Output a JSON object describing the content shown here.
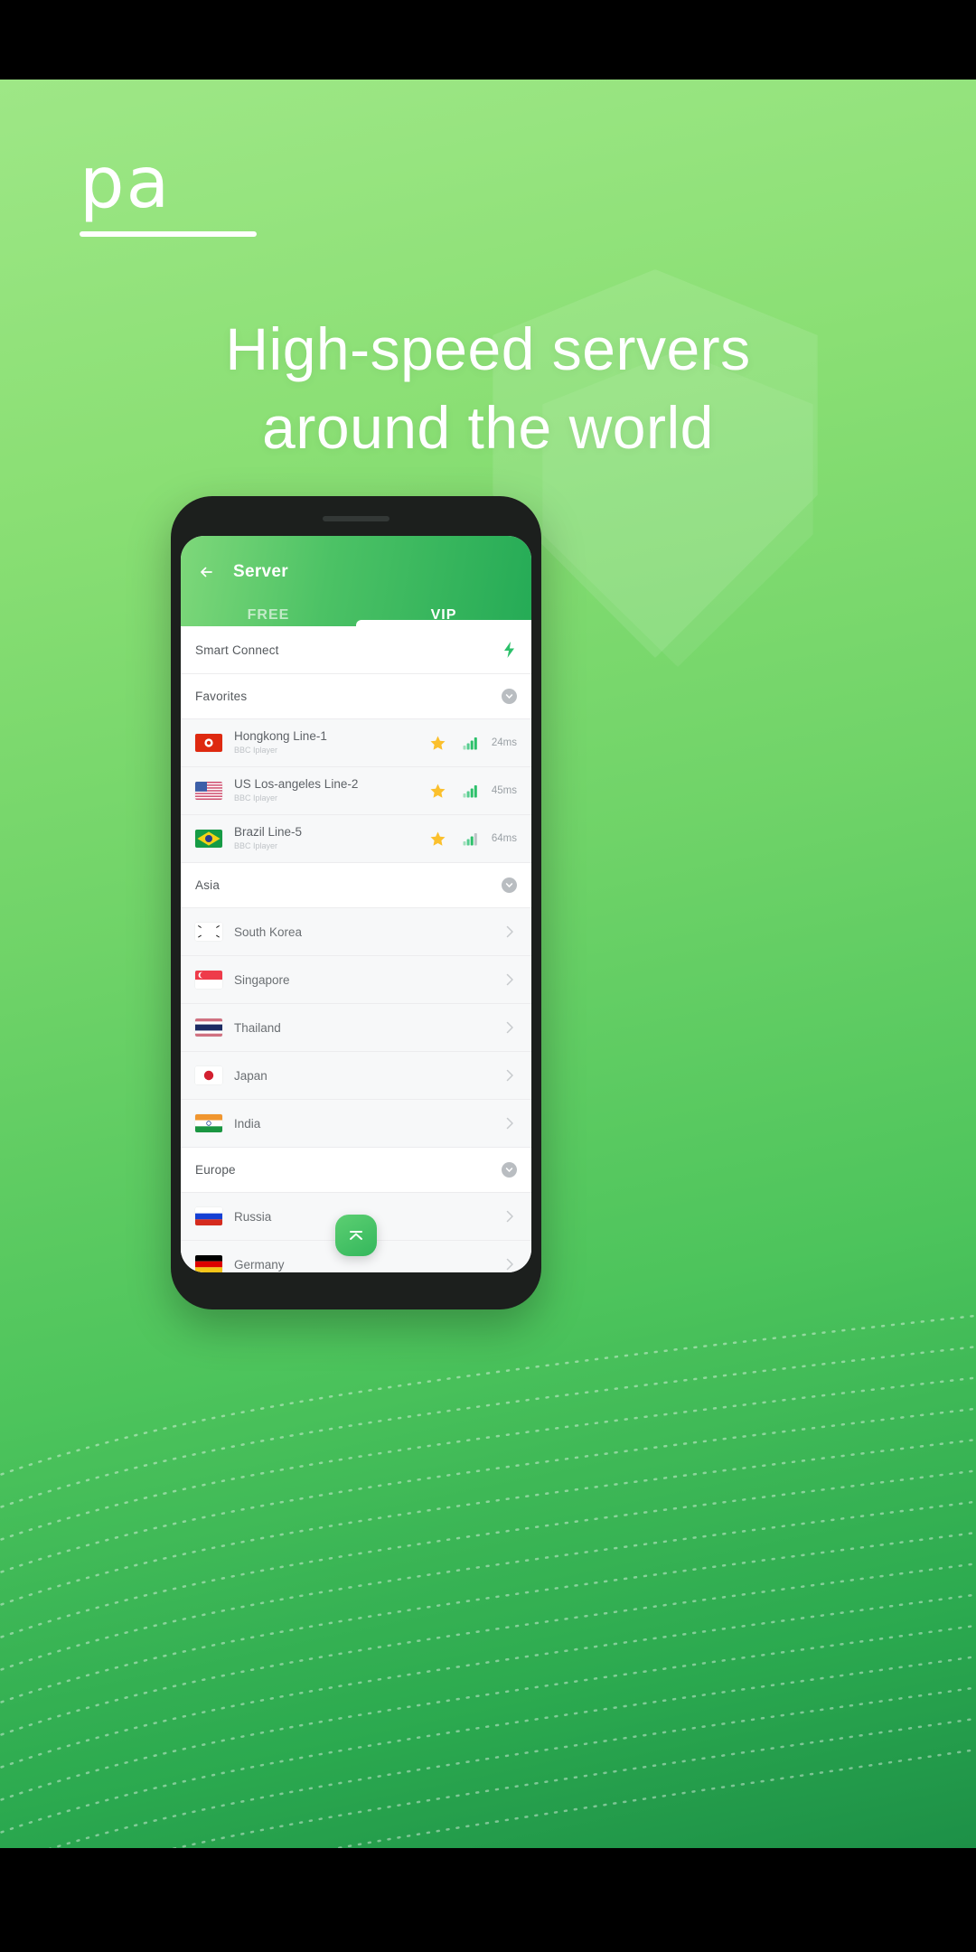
{
  "poster": {
    "logo_mark": "pa",
    "headline_line1": "High-speed servers",
    "headline_line2": "around the world",
    "background_color_top": "#9ee786",
    "background_color_bottom": "#1d9047",
    "headline_color": "#ffffff"
  },
  "app": {
    "title": "Server",
    "back_icon": "back-arrow-icon",
    "accent_color": "#2ba94f",
    "tabs": [
      {
        "label": "FREE",
        "active": false
      },
      {
        "label": "VIP",
        "active": true
      }
    ],
    "smart_connect": {
      "label": "Smart Connect",
      "icon": "lightning-bolt-icon",
      "icon_color": "#2cc06a"
    },
    "sections": [
      {
        "title": "Favorites",
        "toggle_icon": "circle-chevron-down-icon",
        "type": "servers",
        "rows": [
          {
            "flag": "hongkong-flag",
            "name": "Hongkong Line-1",
            "sub": "BBC Iplayer",
            "favorite_icon": "star-icon",
            "signal_icon": "signal-bars-icon",
            "ping": "24ms"
          },
          {
            "flag": "us-flag",
            "name": "US Los-angeles Line-2",
            "sub": "BBC Iplayer",
            "favorite_icon": "star-icon",
            "signal_icon": "signal-bars-icon",
            "ping": "45ms"
          },
          {
            "flag": "brazil-flag",
            "name": "Brazil Line-5",
            "sub": "BBC Iplayer",
            "favorite_icon": "star-icon",
            "signal_icon": "signal-bars-icon",
            "ping": "64ms"
          }
        ]
      },
      {
        "title": "Asia",
        "toggle_icon": "circle-chevron-down-icon",
        "type": "countries",
        "rows": [
          {
            "flag": "south-korea-flag",
            "name": "South Korea",
            "chevron": "chevron-right-icon"
          },
          {
            "flag": "singapore-flag",
            "name": "Singapore",
            "chevron": "chevron-right-icon"
          },
          {
            "flag": "thailand-flag",
            "name": "Thailand",
            "chevron": "chevron-right-icon"
          },
          {
            "flag": "japan-flag",
            "name": "Japan",
            "chevron": "chevron-right-icon"
          },
          {
            "flag": "india-flag",
            "name": "India",
            "chevron": "chevron-right-icon"
          }
        ]
      },
      {
        "title": "Europe",
        "toggle_icon": "circle-chevron-down-icon",
        "type": "countries",
        "rows": [
          {
            "flag": "russia-flag",
            "name": "Russia",
            "chevron": "chevron-right-icon"
          },
          {
            "flag": "germany-flag",
            "name": "Germany",
            "chevron": "chevron-right-icon"
          }
        ]
      }
    ],
    "scroll_top_button": {
      "icon": "scroll-to-top-icon",
      "color": "#34b75c"
    }
  }
}
